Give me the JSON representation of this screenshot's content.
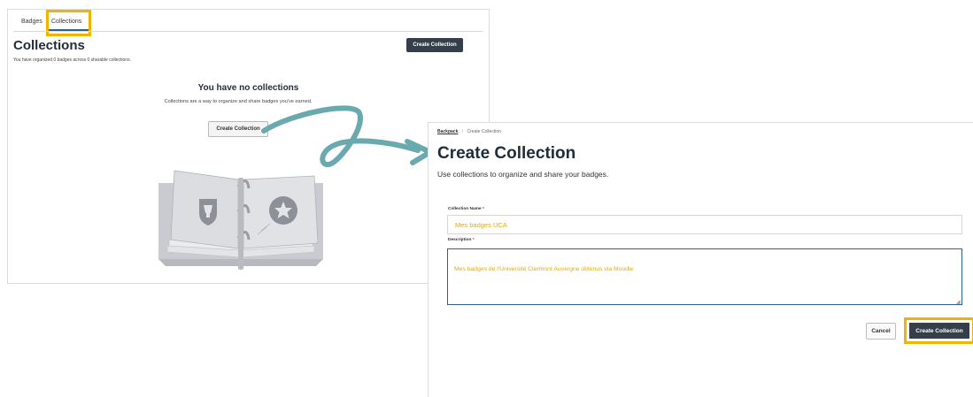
{
  "tabs": {
    "badges": "Badges",
    "collections": "Collections"
  },
  "collections_page": {
    "title": "Collections",
    "summary": "You have organized 0 badges across 0 sharable collections.",
    "create_button": "Create Collection",
    "empty_title": "You have no collections",
    "empty_description": "Collections are a way to organize and share badges you've earned.",
    "empty_create_button": "Create Collection"
  },
  "form": {
    "breadcrumb": {
      "parent": "Backpack",
      "current": "Create Collection",
      "separator": "/"
    },
    "title": "Create Collection",
    "subtitle": "Use collections to organize and share your badges.",
    "name_label": "Collection Name",
    "name_value": "Mes badges UCA",
    "description_label": "Description",
    "description_value": "Mes badges de l'Université Clermont Auvergne obtenus via Moodle",
    "required_marker": "*",
    "cancel_button": "Cancel",
    "create_button": "Create Collection"
  },
  "colors": {
    "highlight": "#f0b400",
    "primary_button": "#353f49",
    "arrow": "#6aa9ad",
    "input_text": "#e6a800"
  },
  "icons": [
    "binder-illustration-icon",
    "shield-badge-icon",
    "star-badge-icon",
    "curved-arrow-icon"
  ]
}
